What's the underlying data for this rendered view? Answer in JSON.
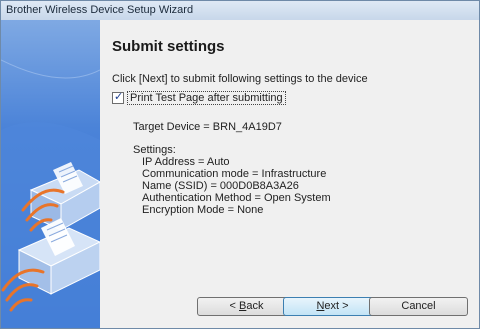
{
  "window": {
    "title": "Brother Wireless Device Setup Wizard"
  },
  "page": {
    "heading": "Submit settings",
    "instruction": "Click [Next] to submit following settings to the device",
    "print_test_page": {
      "label": "Print Test Page after submitting",
      "checked": true
    },
    "target_device": "Target Device = BRN_4A19D7",
    "settings_header": "Settings:",
    "settings": [
      "IP Address = Auto",
      "Communication mode = Infrastructure",
      "Name (SSID) = 000D0B8A3A26",
      "Authentication Method = Open System",
      "Encryption Mode = None"
    ]
  },
  "buttons": {
    "back_prefix": "< ",
    "back_mnemonic": "B",
    "back_rest": "ack",
    "next_mnemonic": "N",
    "next_rest": "ext >",
    "cancel": "Cancel"
  },
  "colors": {
    "sidebar_blue": "#3a76d2",
    "wifi_orange": "#e8742a"
  }
}
